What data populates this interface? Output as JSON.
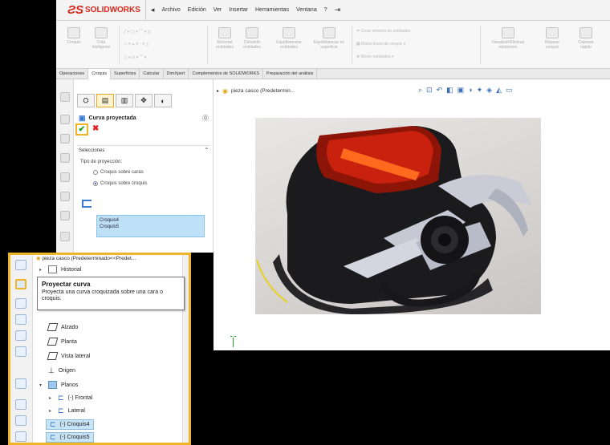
{
  "app": {
    "brand": "SOLIDWORKS",
    "accent_color": "#f0b429",
    "brand_color": "#d9261c"
  },
  "menu": [
    "Archivo",
    "Edición",
    "Ver",
    "Insertar",
    "Herramientas",
    "Ventana",
    "?"
  ],
  "ribbon": {
    "buttons": [
      "Croquis",
      "Cota inteligente",
      "Recortar entidades",
      "Convertir entidades",
      "Equidistanciar entidades",
      "Equidistanciar en superficie"
    ],
    "small_items": [
      "Crear simetría de entidades",
      "Matriz lineal de croquis",
      "Mover entidades"
    ],
    "right_buttons": [
      "Visualizar/Eliminar relaciones",
      "Reparar croquis",
      "Capturar rápido"
    ]
  },
  "tabs": [
    "Operaciones",
    "Croquis",
    "Superficies",
    "Calcular",
    "DimXpert",
    "Complementos de SOLIDWORKS",
    "Preparación del análisis"
  ],
  "property_manager": {
    "title": "Curva proyectada",
    "section": "Selecciones",
    "projection_type_label": "Tipo de proyección:",
    "option_faces": "Croquis sobre caras",
    "option_sketches": "Croquis sobre croquis",
    "selection_1": "Croquis4",
    "selection_2": "Croquis5"
  },
  "viewport": {
    "doc_title": "pieza casco  (Predetermin..."
  },
  "tree": {
    "root": "pieza casco  (Predeterminado<<Predet...",
    "items": [
      {
        "label": "Historial"
      },
      {
        "label": "Alzado"
      },
      {
        "label": "Planta"
      },
      {
        "label": "Vista lateral"
      },
      {
        "label": "Origen"
      },
      {
        "label": "Planos"
      },
      {
        "label": "(-) Frontal"
      },
      {
        "label": "Lateral"
      },
      {
        "label": "(-) Croquis4"
      },
      {
        "label": "(-) Croquis5"
      }
    ]
  },
  "tooltip": {
    "title": "Proyectar curva",
    "body": "Proyecta una curva croquizada sobre una cara o croquis."
  }
}
